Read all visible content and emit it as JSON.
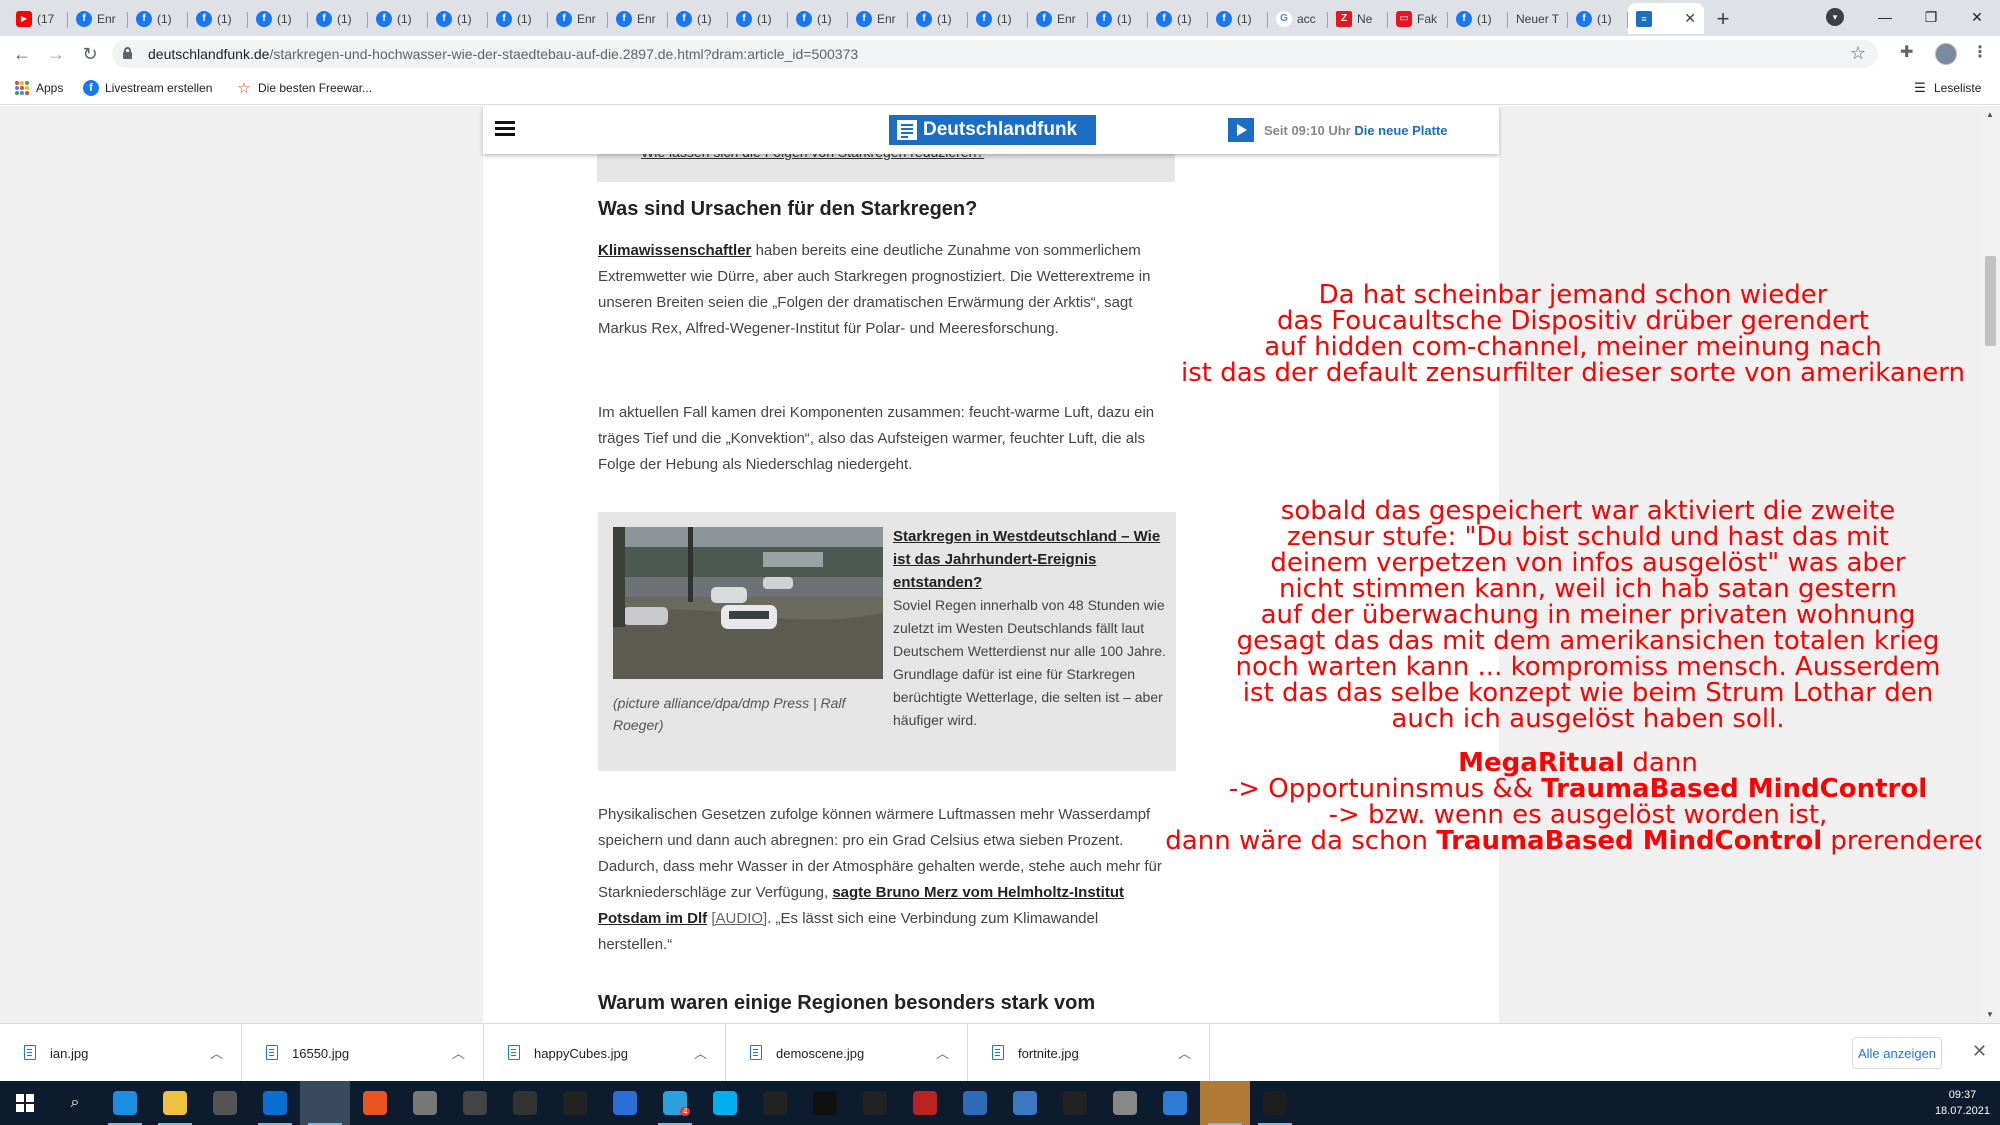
{
  "browser": {
    "tabs": [
      {
        "icon": "youtube-icon",
        "label": "(17",
        "color": "#ff0000"
      },
      {
        "icon": "facebook-icon",
        "label": "Enr",
        "color": "#1877f2"
      },
      {
        "icon": "facebook-icon",
        "label": "(1)",
        "color": "#1877f2"
      },
      {
        "icon": "facebook-icon",
        "label": "(1)",
        "color": "#1877f2"
      },
      {
        "icon": "facebook-icon",
        "label": "(1)",
        "color": "#1877f2"
      },
      {
        "icon": "facebook-icon",
        "label": "(1)",
        "color": "#1877f2"
      },
      {
        "icon": "facebook-icon",
        "label": "(1)",
        "color": "#1877f2"
      },
      {
        "icon": "facebook-icon",
        "label": "(1)",
        "color": "#1877f2"
      },
      {
        "icon": "facebook-icon",
        "label": "(1)",
        "color": "#1877f2"
      },
      {
        "icon": "facebook-icon",
        "label": "Enr",
        "color": "#1877f2"
      },
      {
        "icon": "facebook-icon",
        "label": "Enr",
        "color": "#1877f2"
      },
      {
        "icon": "facebook-icon",
        "label": "(1)",
        "color": "#1877f2"
      },
      {
        "icon": "facebook-icon",
        "label": "(1)",
        "color": "#1877f2"
      },
      {
        "icon": "facebook-icon",
        "label": "(1)",
        "color": "#1877f2"
      },
      {
        "icon": "facebook-icon",
        "label": "Enr",
        "color": "#1877f2"
      },
      {
        "icon": "facebook-icon",
        "label": "(1)",
        "color": "#1877f2"
      },
      {
        "icon": "facebook-icon",
        "label": "(1)",
        "color": "#1877f2"
      },
      {
        "icon": "facebook-icon",
        "label": "Enr",
        "color": "#1877f2"
      },
      {
        "icon": "facebook-icon",
        "label": "(1)",
        "color": "#1877f2"
      },
      {
        "icon": "facebook-icon",
        "label": "(1)",
        "color": "#1877f2"
      },
      {
        "icon": "facebook-icon",
        "label": "(1)",
        "color": "#1877f2"
      },
      {
        "icon": "google-icon",
        "label": "acc",
        "color": "#ffffff"
      },
      {
        "icon": "zeit-icon",
        "label": "Ne",
        "color": "#e8141f"
      },
      {
        "icon": "tv-icon",
        "label": "Fak",
        "color": "#e8141f"
      },
      {
        "icon": "facebook-icon",
        "label": "(1)",
        "color": "#1877f2"
      },
      {
        "icon": "blank-icon",
        "label": "Neuer T",
        "color": "#dee1e6"
      },
      {
        "icon": "facebook-icon",
        "label": "(1)",
        "color": "#1877f2"
      }
    ],
    "active_tab_icon": "dlf-doc-icon",
    "url_host": "deutschlandfunk.de",
    "url_path": "/starkregen-und-hochwasser-wie-der-staedtebau-auf-die.2897.de.html?dram:article_id=500373",
    "bookmarks": [
      "Apps",
      "Livestream erstellen",
      "Die besten Freewar..."
    ],
    "reading_list": "Leseliste"
  },
  "site": {
    "brand": "Deutschlandfunk",
    "now_playing_prefix": "Seit 09:10 Uhr",
    "now_playing_program": "Die neue Platte",
    "brand_color": "#1c6ec5"
  },
  "article": {
    "cut_link": "Wie lassen sich die Folgen von Starkregen reduzieren?",
    "heading1": "Was sind Ursachen für den Starkregen?",
    "p1_link": "Klimawissenschaftler",
    "p1_text": " haben bereits eine deutliche Zunahme von sommerlichem Extremwetter wie Dürre, aber auch Starkregen prognostiziert. Die Wetterextreme in unseren Breiten seien die „Folgen der dramatischen Erwärmung der Arktis“, sagt Markus Rex, Alfred-Wegener-Institut für Polar- und Meeresforschung.",
    "p2_text": "Im aktuellen Fall kamen drei Komponenten zusammen: feucht-warme Luft, dazu ein träges Tief und die „Konvektion“, also das Aufsteigen warmer, feuchter Luft, die als Folge der Hebung als Niederschlag niedergeht.",
    "teaser_title": "Starkregen in Westdeutschland – Wie ist das Jahrhundert-Ereignis entstanden?",
    "teaser_body": "Soviel Regen innerhalb von 48 Stunden wie zuletzt im Westen Deutschlands fällt laut Deutschem Wetterdienst nur alle 100 Jahre. Grundlage dafür ist eine für Starkregen berüchtigte Wetterlage, die selten ist – aber häufiger wird.",
    "teaser_caption": "(picture alliance/dpa/dmp Press | Ralf Roeger)",
    "p3_text_a": "Physikalischen Gesetzen zufolge können wärmere Luftmassen mehr Wasserdampf speichern und dann auch abregnen: pro ein Grad Celsius etwa sieben Prozent. Dadurch, dass mehr Wasser in der Atmosphäre gehalten werde, stehe auch mehr für Starkniederschläge zur Verfügung, ",
    "p3_link": "sagte Bruno Merz vom Helmholtz-Institut Potsdam im Dlf",
    "p3_audio": "[AUDIO]",
    "p3_text_b": ". „Es lässt sich eine Verbindung zum Klimawandel herstellen.“",
    "heading2": "Warum waren einige Regionen besonders stark vom"
  },
  "overlay": {
    "block1": [
      "Da hat scheinbar jemand schon wieder",
      "das Foucaultsche Dispositiv drüber gerendert",
      "auf hidden com-channel, meiner meinung nach",
      "ist das der default zensurfilter dieser sorte von amerikanern"
    ],
    "block2": [
      "sobald das gespeichert war aktiviert die zweite",
      "zensur stufe: \"Du bist schuld und hast das mit",
      "deinem verpetzen von infos ausgelöst\" was aber",
      "nicht stimmen kann, weil ich hab satan gestern",
      "auf der überwachung in meiner privaten wohnung",
      "gesagt das das mit dem amerikansichen totalen krieg",
      "noch warten kann ... kompromiss mensch. Ausserdem",
      "ist das das selbe konzept wie beim Strum Lothar den",
      "auch ich ausgelöst haben soll."
    ],
    "block3": {
      "l1_bold": "MegaRitual",
      "l1_rest": " dann",
      "l2_pre": "-> Opportuninsmus && ",
      "l2_bold": "TraumaBased MindControl",
      "l3": "-> bzw. wenn es ausgelöst worden ist,",
      "l4_pre": "dann wäre da schon ",
      "l4_bold": "TraumaBased MindControl",
      "l4_post": " prerendered"
    },
    "color": "#ff0000"
  },
  "downloads": {
    "files": [
      "ian.jpg",
      "16550.jpg",
      "happyCubes.jpg",
      "demoscene.jpg",
      "fortnite.jpg"
    ],
    "show_all": "Alle anzeigen"
  },
  "taskbar": {
    "time": "09:37",
    "date": "18.07.2021",
    "apps": [
      "windows-start-icon",
      "search-icon",
      "edge-icon",
      "file-explorer-icon",
      "store-icon",
      "mail-icon",
      "chrome-icon",
      "ubuntu-icon",
      "app-icon",
      "app-icon",
      "inkscape-icon",
      "live-icon",
      "teams-icon",
      "telegram-icon",
      "skype-icon",
      "app-icon",
      "kali-icon",
      "app-icon",
      "voicemeeter-icon",
      "app-icon",
      "virtualbox-icon",
      "obs-icon",
      "app-icon",
      "app-icon",
      "notepad-icon",
      "terminal-icon"
    ],
    "telegram_badge": "4"
  }
}
